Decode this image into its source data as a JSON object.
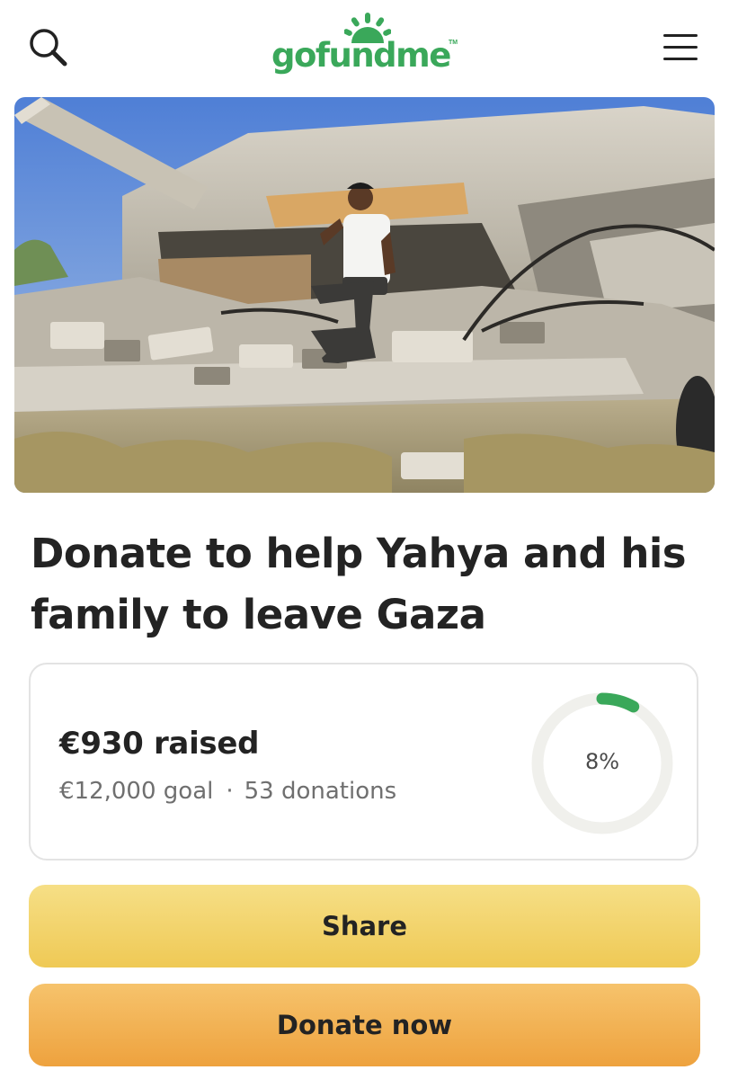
{
  "header": {
    "logo_text": "gofundme",
    "logo_tm": "TM",
    "brand_color": "#3aa85a",
    "search_icon": "search-icon",
    "menu_icon": "hamburger-menu-icon"
  },
  "hero": {
    "image": "photo of a young man making a peace sign, sitting on the rubble of a collapsed concrete building under a blue sky"
  },
  "campaign": {
    "title": "Donate to help Yahya and his family to leave Gaza",
    "raised": "€930 raised",
    "goal": "€12,000 goal",
    "separator": "·",
    "donations": "53 donations",
    "progress_label": "8%",
    "progress_fraction": 0.08,
    "progress_color": "#3aa85a",
    "progress_track_color": "#f0f0ec"
  },
  "actions": {
    "share_label": "Share",
    "donate_label": "Donate now",
    "share_color": "#f2d46c",
    "donate_color": "#f1b04f"
  }
}
